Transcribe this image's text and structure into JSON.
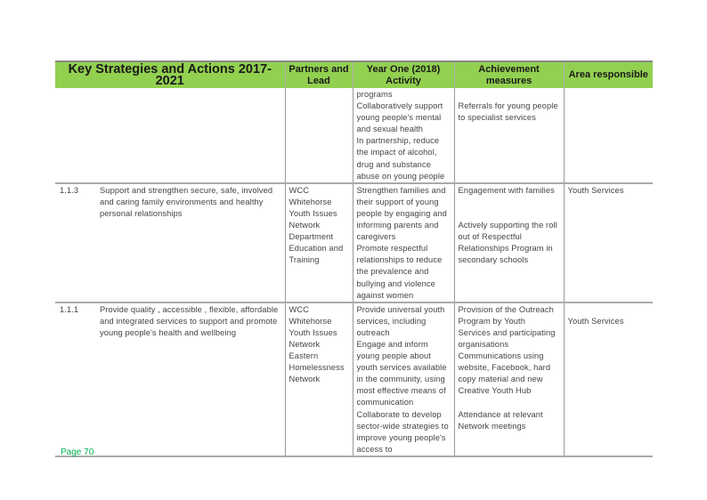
{
  "table": {
    "headers": {
      "strategy": "Key Strategies and Actions 2017-2021",
      "partners": "Partners and Lead",
      "activity": "Year One (2018) Activity",
      "achievement": "Achievement measures",
      "area": "Area responsible"
    },
    "header_color": "#92d050",
    "rows": [
      {
        "num": "",
        "strategy": "",
        "partners": "",
        "activity": "programs\nCollaboratively support young people's mental and sexual health\nIn partnership, reduce the impact of alcohol, drug and substance abuse on young people",
        "achievement": "\nReferrals for young people to specialist services",
        "area": ""
      },
      {
        "num": "1.1.3",
        "strategy": "Support and strengthen secure, safe, involved and caring family environments and healthy personal relationships",
        "partners": "WCC\nWhitehorse Youth Issues Network\nDepartment Education and Training",
        "activity": "Strengthen families and their support of young people by engaging and informing  parents and caregivers\nPromote respectful relationships to reduce the prevalence and bullying and violence against women",
        "achievement": "Engagement with families\n\n\nActively supporting the roll out of Respectful Relationships Program in secondary schools",
        "area": "Youth Services"
      },
      {
        "num": "1.1.1",
        "strategy": "Provide quality , accessible , flexible, affordable and integrated services to support and promote young people's health and wellbeing",
        "partners": "WCC\nWhitehorse Youth Issues Network\nEastern Homelessness Network",
        "activity": "Provide universal youth services, including outreach\nEngage and inform young people about youth services available in the community, using most effective means of communication\nCollaborate to develop sector-wide strategies to improve young people's access to",
        "achievement": "Provision of the Outreach Program by Youth Services and participating organisations\nCommunications using website, Facebook, hard copy material and new Creative Youth Hub\n\nAttendance at relevant Network meetings",
        "area": "\nYouth Services"
      }
    ]
  },
  "footer": {
    "page": "Page 70",
    "color": "#00b050"
  }
}
